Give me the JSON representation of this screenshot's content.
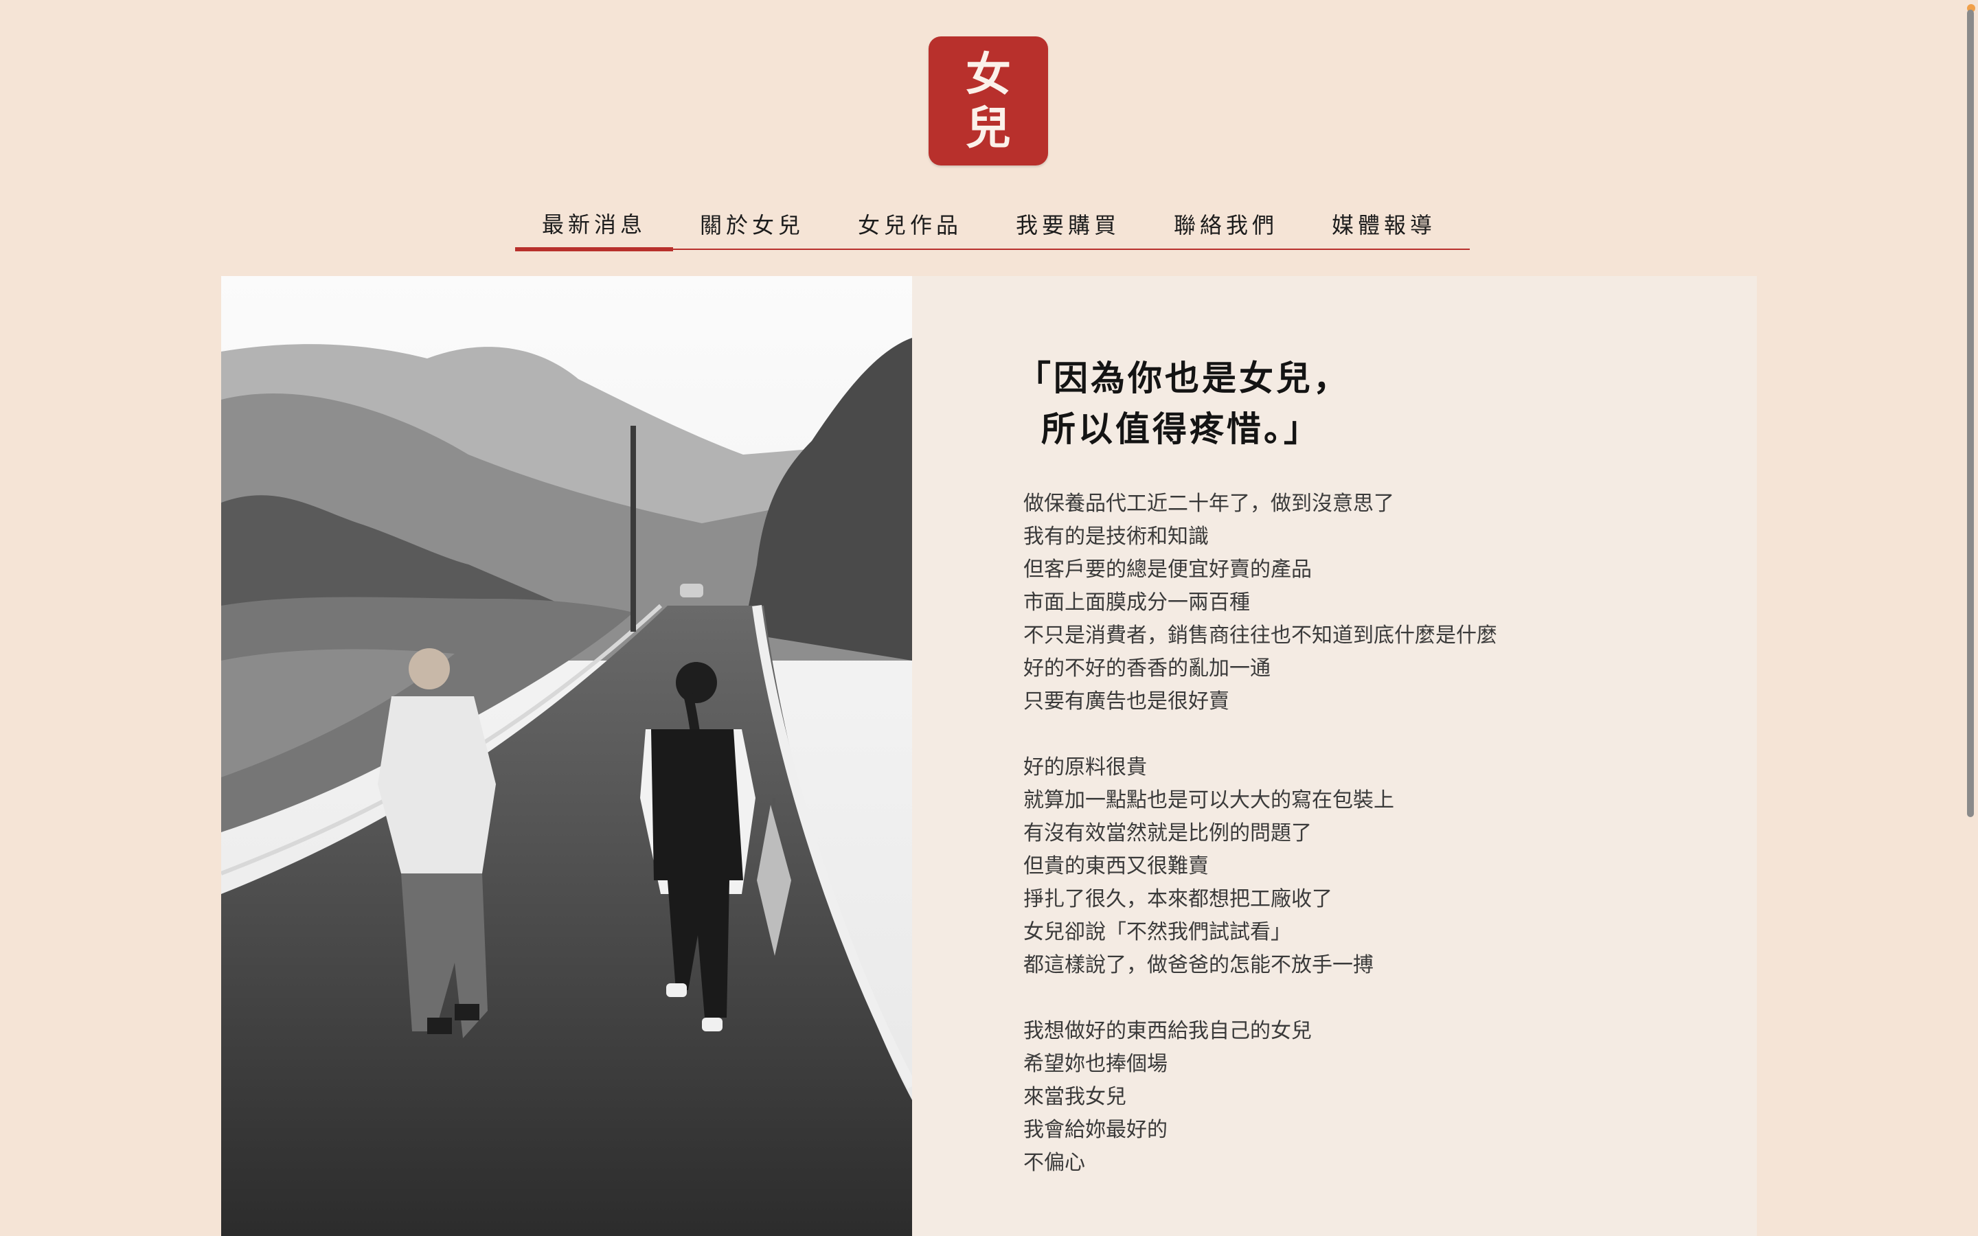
{
  "logo": {
    "line1": "女",
    "line2": "兒",
    "brand_color": "#b8302c"
  },
  "nav": {
    "items": [
      {
        "label": "最新消息",
        "active": true
      },
      {
        "label": "關於女兒",
        "active": false
      },
      {
        "label": "女兒作品",
        "active": false
      },
      {
        "label": "我要購買",
        "active": false
      },
      {
        "label": "聯絡我們",
        "active": false
      },
      {
        "label": "媒體報導",
        "active": false
      }
    ]
  },
  "content": {
    "heading": {
      "line1": "「因為你也是女兒，",
      "line2": "所以值得疼惜。」"
    },
    "paragraphs": [
      [
        "做保養品代工近二十年了，做到沒意思了",
        "我有的是技術和知識",
        "但客戶要的總是便宜好賣的產品",
        "市面上面膜成分一兩百種",
        "不只是消費者，銷售商往往也不知道到底什麼是什麼",
        "好的不好的香香的亂加一通",
        "只要有廣告也是很好賣"
      ],
      [
        "好的原料很貴",
        "就算加一點點也是可以大大的寫在包裝上",
        "有沒有效當然就是比例的問題了",
        "但貴的東西又很難賣",
        "掙扎了很久，本來都想把工廠收了",
        "女兒卻說「不然我們試試看」",
        "都這樣說了，做爸爸的怎能不放手一搏"
      ],
      [
        "我想做好的東西給我自己的女兒",
        "希望妳也捧個場",
        "來當我女兒",
        "我會給妳最好的",
        "不偏心"
      ]
    ]
  },
  "colors": {
    "page_bg": "#f5e4d6",
    "card_bg": "#f4ebe3",
    "accent": "#b8302c"
  }
}
